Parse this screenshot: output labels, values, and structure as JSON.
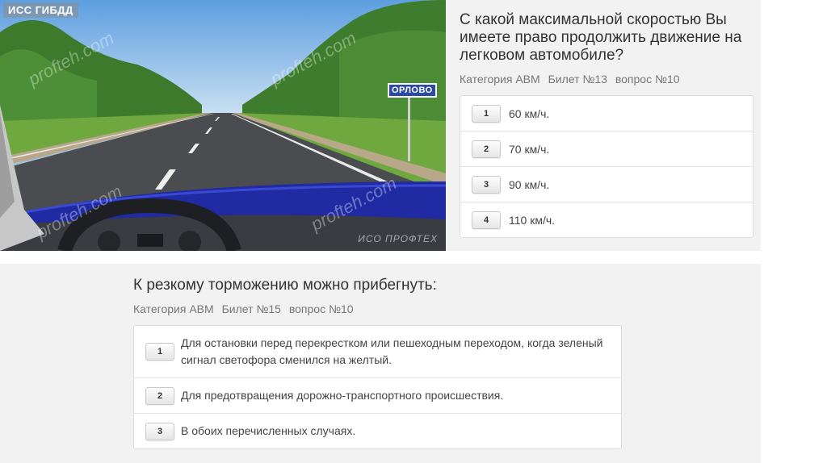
{
  "card1": {
    "image": {
      "logo": "ИСС ГИБДД",
      "sign_text": "ОРЛОВО",
      "watermark": "profteh.com",
      "brand": "ИСО ПРОФТЕХ"
    },
    "question": "С какой максимальной скоростью Вы имеете право продолжить движение на легковом автомобиле?",
    "meta": {
      "category": "Категория ABM",
      "ticket": "Билет №13",
      "question_no": "вопрос №10"
    },
    "answers": [
      {
        "num": "1",
        "text": "60 км/ч."
      },
      {
        "num": "2",
        "text": "70 км/ч."
      },
      {
        "num": "3",
        "text": "90 км/ч."
      },
      {
        "num": "4",
        "text": "110 км/ч."
      }
    ]
  },
  "card2": {
    "question": "К резкому торможению можно прибегнуть:",
    "meta": {
      "category": "Категория ABM",
      "ticket": "Билет №15",
      "question_no": "вопрос №10"
    },
    "answers": [
      {
        "num": "1",
        "text": "Для остановки перед перекрестком или пешеходным переходом, когда зеленый сигнал светофора сменился на желтый."
      },
      {
        "num": "2",
        "text": "Для предотвращения дорожно-транспортного происшествия."
      },
      {
        "num": "3",
        "text": "В обоих перечисленных случаях."
      }
    ]
  },
  "colors": {
    "card_bg": "#f2f2f2",
    "sky": "#9cc4e8",
    "sign_blue": "#2b4aa8",
    "hood_blue": "#1f2aa3"
  }
}
